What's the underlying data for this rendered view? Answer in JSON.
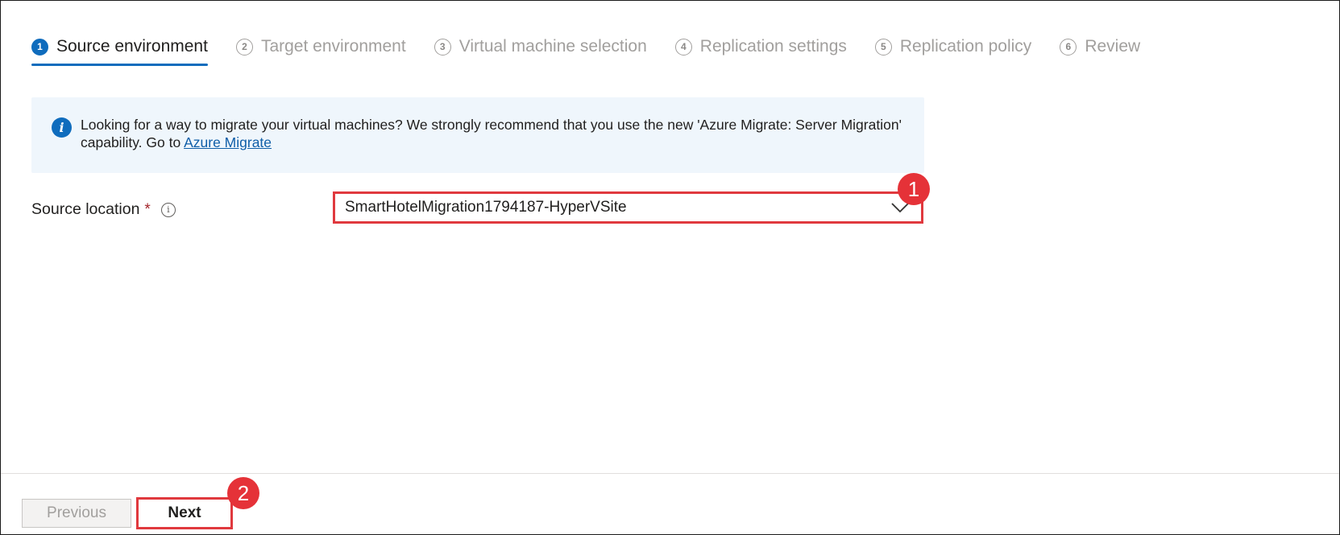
{
  "steps": [
    {
      "number": "1",
      "label": "Source environment",
      "active": true
    },
    {
      "number": "2",
      "label": "Target environment",
      "active": false
    },
    {
      "number": "3",
      "label": "Virtual machine selection",
      "active": false
    },
    {
      "number": "4",
      "label": "Replication settings",
      "active": false
    },
    {
      "number": "5",
      "label": "Replication policy",
      "active": false
    },
    {
      "number": "6",
      "label": "Review",
      "active": false
    }
  ],
  "info_banner": {
    "icon": "info-icon",
    "text": "Looking for a way to migrate your virtual machines? We strongly recommend that you use the new 'Azure Migrate: Server Migration' capability. Go to ",
    "link_text": "Azure Migrate"
  },
  "source_location": {
    "label": "Source location",
    "required_marker": "*",
    "value": "SmartHotelMigration1794187-HyperVSite"
  },
  "callouts": [
    "1",
    "2"
  ],
  "footer": {
    "previous_label": "Previous",
    "next_label": "Next"
  },
  "colors": {
    "accent": "#0f6cbd",
    "highlight": "#e0393e",
    "banner_bg": "#eff6fc"
  }
}
